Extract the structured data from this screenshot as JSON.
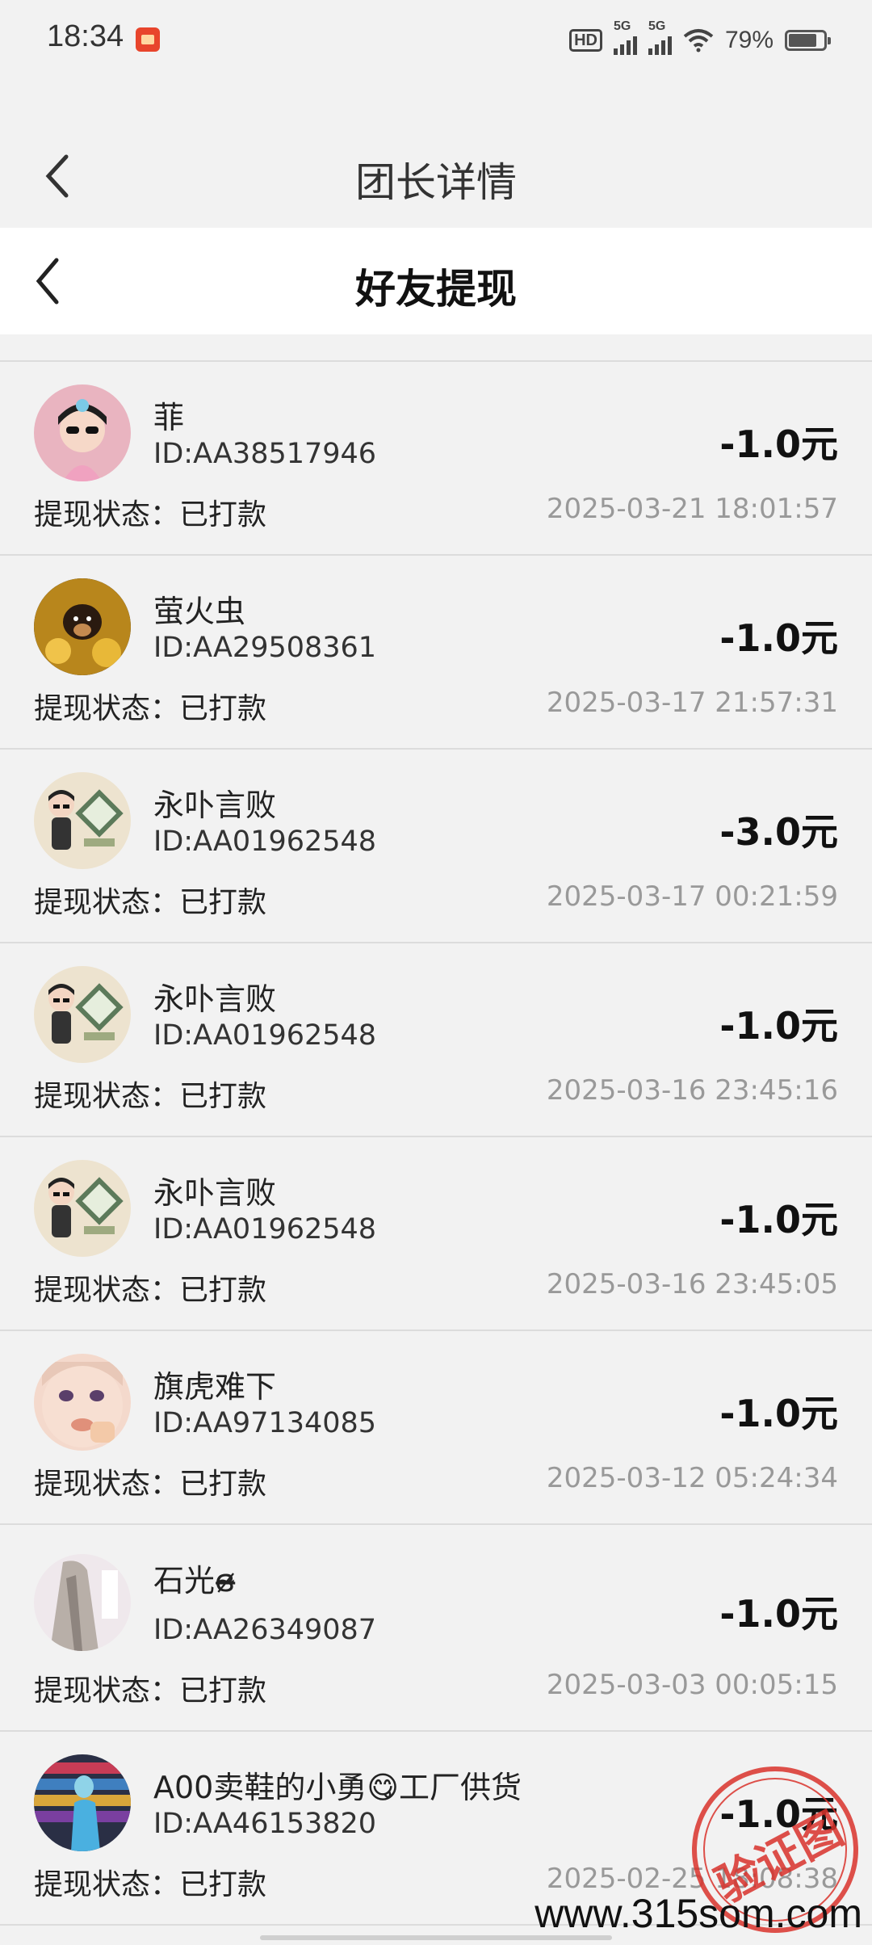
{
  "status_bar": {
    "time": "18:34",
    "network_1": "5G",
    "network_2": "5G",
    "battery_percent": "79%",
    "battery_level": 0.79
  },
  "outer_header": {
    "title": "团长详情"
  },
  "inner_header": {
    "title": "好友提现"
  },
  "status_label": "提现状态：",
  "records": [
    {
      "name": "菲",
      "id": "ID:AA38517946",
      "amount": "-1.0元",
      "status": "已打款",
      "time": "2025-03-21 18:01:57"
    },
    {
      "name": "萤火虫",
      "id": "ID:AA29508361",
      "amount": "-1.0元",
      "status": "已打款",
      "time": "2025-03-17 21:57:31"
    },
    {
      "name": "永卟言败",
      "id": "ID:AA01962548",
      "amount": "-3.0元",
      "status": "已打款",
      "time": "2025-03-17 00:21:59"
    },
    {
      "name": "永卟言败",
      "id": "ID:AA01962548",
      "amount": "-1.0元",
      "status": "已打款",
      "time": "2025-03-16 23:45:16"
    },
    {
      "name": "永卟言败",
      "id": "ID:AA01962548",
      "amount": "-1.0元",
      "status": "已打款",
      "time": "2025-03-16 23:45:05"
    },
    {
      "name": "旗虎难下",
      "id": "ID:AA97134085",
      "amount": "-1.0元",
      "status": "已打款",
      "time": "2025-03-12 05:24:34"
    },
    {
      "name": "石光ɞ̴̶̷ ",
      "id": "ID:AA26349087",
      "amount": "-1.0元",
      "status": "已打款",
      "time": "2025-03-03 00:05:15"
    },
    {
      "name": "A00卖鞋的小勇😋工厂供货",
      "id": "ID:AA46153820",
      "amount": "-1.0元",
      "status": "已打款",
      "time": "2025-02-25 18:08:38"
    }
  ],
  "stamp_text": "验证图",
  "watermark": "www.315som.com"
}
